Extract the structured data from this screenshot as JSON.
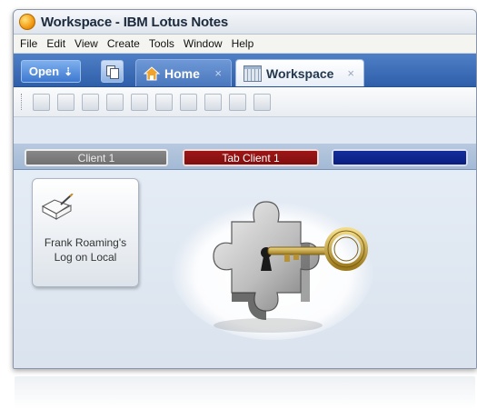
{
  "window": {
    "title": "Workspace - IBM Lotus Notes"
  },
  "menu": [
    "File",
    "Edit",
    "View",
    "Create",
    "Tools",
    "Window",
    "Help"
  ],
  "tabs": {
    "open_label": "Open",
    "home_label": "Home",
    "workspace_label": "Workspace",
    "close_glyph": "×"
  },
  "workspace_tabs": [
    {
      "label": "Client 1",
      "color": "#7a7a7a"
    },
    {
      "label": "Tab Client 1",
      "color": "#8f1212"
    },
    {
      "label": "",
      "color": "#0f2590"
    }
  ],
  "database_tile": {
    "title_line1": "Frank Roaming's",
    "title_line2": "Log on Local"
  },
  "icons": {
    "app": "lotus-notes-icon",
    "open_arrow": "arrow-down-icon",
    "home": "house-icon",
    "workspace": "workspace-grid-icon",
    "database": "open-book-icon",
    "art": "puzzle-key-icon"
  },
  "colors": {
    "title_bar": "#e6ebf1",
    "tab_strip": "#3f6db7",
    "active_ws_tab": "#8f1212"
  }
}
